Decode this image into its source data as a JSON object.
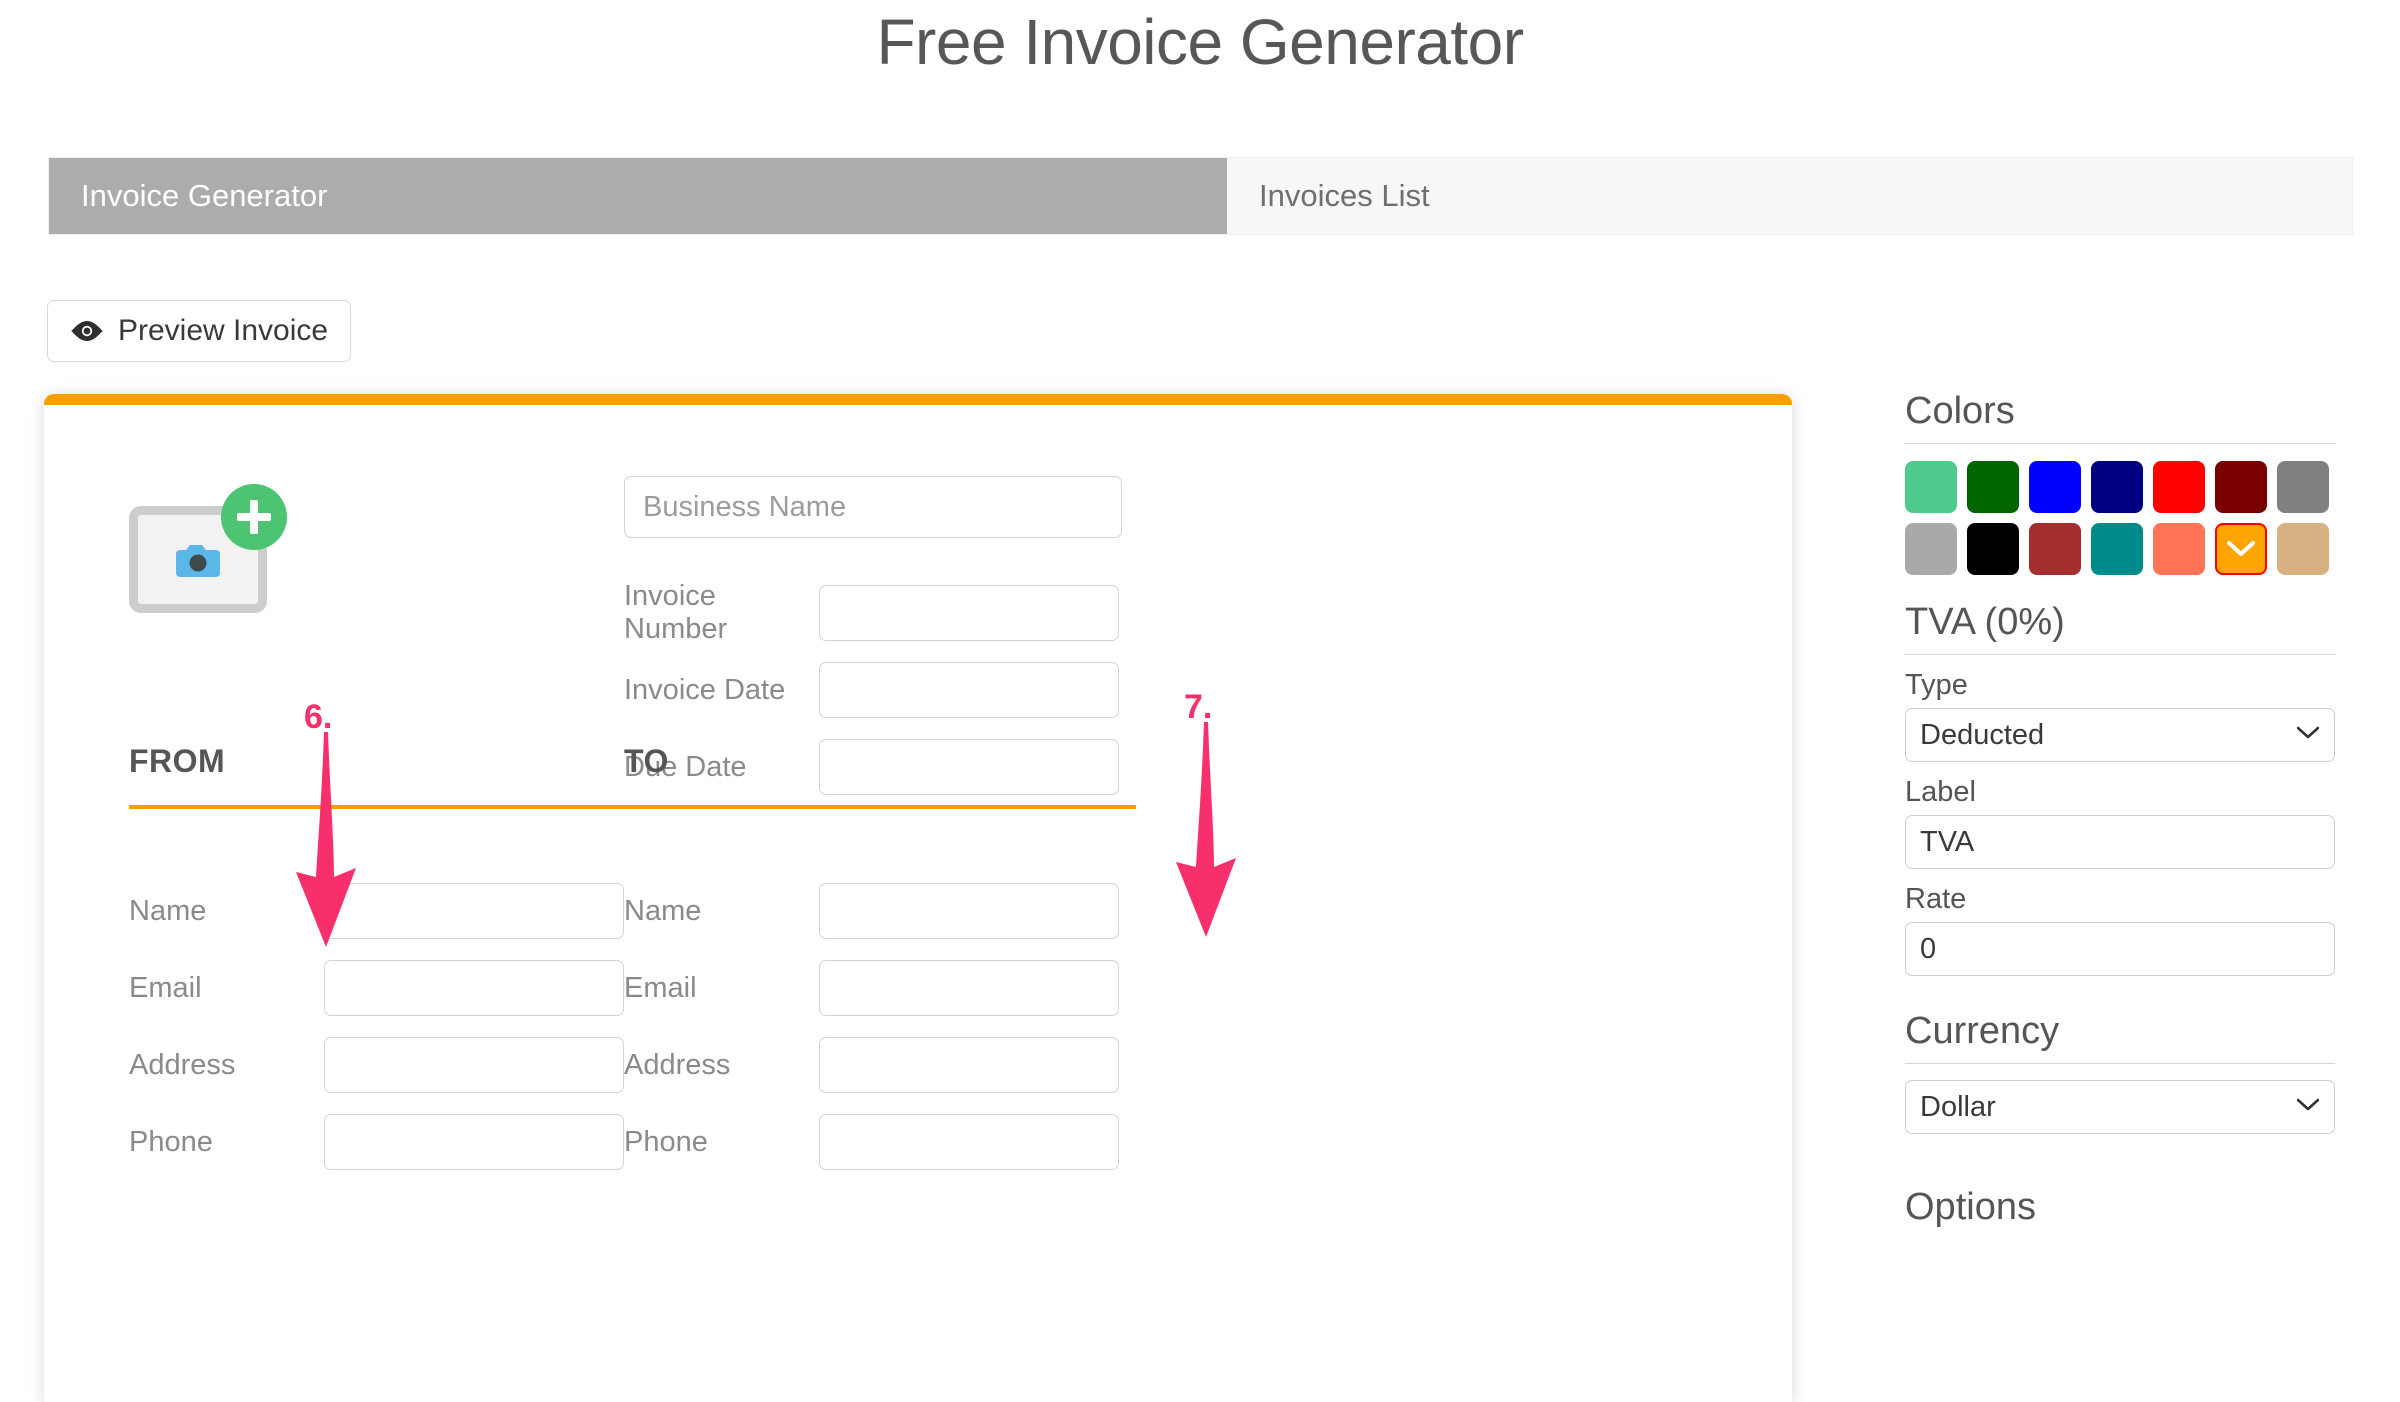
{
  "page": {
    "title": "Free Invoice Generator"
  },
  "tabs": [
    {
      "label": "Invoice Generator",
      "active": true
    },
    {
      "label": "Invoices List",
      "active": false
    }
  ],
  "toolbar": {
    "preview_label": "Preview Invoice",
    "preview_icon": "eye-icon"
  },
  "invoice_card": {
    "logo": {
      "frame_icon": "camera-icon",
      "add_badge_icon": "plus-circle-icon"
    },
    "business_name": {
      "placeholder": "Business Name",
      "value": ""
    },
    "meta_fields": [
      {
        "label": "Invoice Number",
        "value": ""
      },
      {
        "label": "Invoice Date",
        "value": ""
      },
      {
        "label": "Due Date",
        "value": ""
      }
    ],
    "from": {
      "heading": "FROM",
      "fields": [
        {
          "label": "Name",
          "value": ""
        },
        {
          "label": "Email",
          "value": ""
        },
        {
          "label": "Address",
          "value": ""
        },
        {
          "label": "Phone",
          "value": ""
        }
      ]
    },
    "to": {
      "heading": "TO",
      "fields": [
        {
          "label": "Name",
          "value": ""
        },
        {
          "label": "Email",
          "value": ""
        },
        {
          "label": "Address",
          "value": ""
        },
        {
          "label": "Phone",
          "value": ""
        }
      ]
    },
    "accent_color": "#F5A000"
  },
  "settings": {
    "colors": {
      "title": "Colors",
      "swatches": [
        {
          "hex": "#4ECB8C",
          "selected": false
        },
        {
          "hex": "#006400",
          "selected": false
        },
        {
          "hex": "#0000FF",
          "selected": false
        },
        {
          "hex": "#000080",
          "selected": false
        },
        {
          "hex": "#FF0000",
          "selected": false
        },
        {
          "hex": "#7B0000",
          "selected": false
        },
        {
          "hex": "#808080",
          "selected": false
        },
        {
          "hex": "#A9A9A9",
          "selected": false
        },
        {
          "hex": "#000000",
          "selected": false
        },
        {
          "hex": "#A32E2E",
          "selected": false
        },
        {
          "hex": "#008B8B",
          "selected": false
        },
        {
          "hex": "#FF7357",
          "selected": false
        },
        {
          "hex": "#FFA500",
          "selected": true
        },
        {
          "hex": "#D8B183",
          "selected": false
        }
      ],
      "selected_marker_icon": "chevron-down-icon"
    },
    "tva": {
      "title": "TVA (0%)",
      "type_label": "Type",
      "type_value": "Deducted",
      "label_label": "Label",
      "label_value": "TVA",
      "rate_label": "Rate",
      "rate_value": "0"
    },
    "currency": {
      "title": "Currency",
      "value": "Dollar"
    },
    "options": {
      "title": "Options"
    }
  },
  "annotations": [
    {
      "number": "6.",
      "color": "#F72F6B",
      "target": "from-section"
    },
    {
      "number": "7.",
      "color": "#F72F6B",
      "target": "to-section"
    }
  ]
}
